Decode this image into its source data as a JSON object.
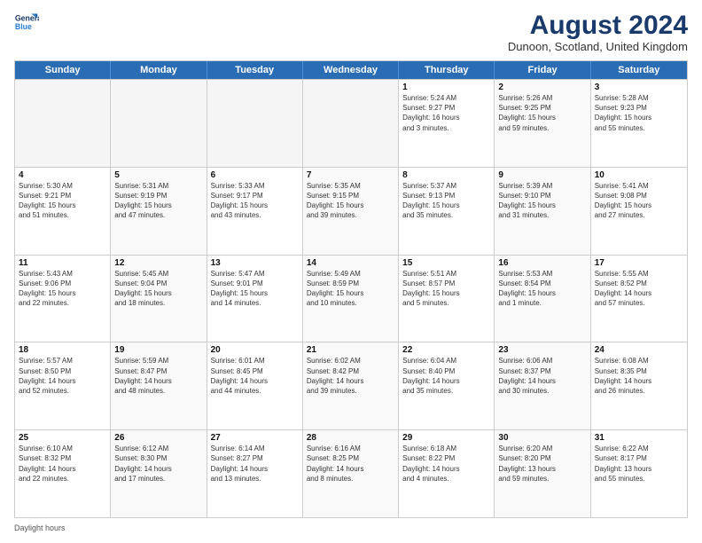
{
  "logo": {
    "line1": "General",
    "line2": "Blue"
  },
  "title": "August 2024",
  "location": "Dunoon, Scotland, United Kingdom",
  "days_of_week": [
    "Sunday",
    "Monday",
    "Tuesday",
    "Wednesday",
    "Thursday",
    "Friday",
    "Saturday"
  ],
  "footer_text": "Daylight hours",
  "weeks": [
    [
      {
        "day": "",
        "empty": true
      },
      {
        "day": "",
        "empty": true
      },
      {
        "day": "",
        "empty": true
      },
      {
        "day": "",
        "empty": true
      },
      {
        "day": "1",
        "info": "Sunrise: 5:24 AM\nSunset: 9:27 PM\nDaylight: 16 hours\nand 3 minutes."
      },
      {
        "day": "2",
        "info": "Sunrise: 5:26 AM\nSunset: 9:25 PM\nDaylight: 15 hours\nand 59 minutes."
      },
      {
        "day": "3",
        "info": "Sunrise: 5:28 AM\nSunset: 9:23 PM\nDaylight: 15 hours\nand 55 minutes."
      }
    ],
    [
      {
        "day": "4",
        "info": "Sunrise: 5:30 AM\nSunset: 9:21 PM\nDaylight: 15 hours\nand 51 minutes."
      },
      {
        "day": "5",
        "info": "Sunrise: 5:31 AM\nSunset: 9:19 PM\nDaylight: 15 hours\nand 47 minutes."
      },
      {
        "day": "6",
        "info": "Sunrise: 5:33 AM\nSunset: 9:17 PM\nDaylight: 15 hours\nand 43 minutes."
      },
      {
        "day": "7",
        "info": "Sunrise: 5:35 AM\nSunset: 9:15 PM\nDaylight: 15 hours\nand 39 minutes."
      },
      {
        "day": "8",
        "info": "Sunrise: 5:37 AM\nSunset: 9:13 PM\nDaylight: 15 hours\nand 35 minutes."
      },
      {
        "day": "9",
        "info": "Sunrise: 5:39 AM\nSunset: 9:10 PM\nDaylight: 15 hours\nand 31 minutes."
      },
      {
        "day": "10",
        "info": "Sunrise: 5:41 AM\nSunset: 9:08 PM\nDaylight: 15 hours\nand 27 minutes."
      }
    ],
    [
      {
        "day": "11",
        "info": "Sunrise: 5:43 AM\nSunset: 9:06 PM\nDaylight: 15 hours\nand 22 minutes."
      },
      {
        "day": "12",
        "info": "Sunrise: 5:45 AM\nSunset: 9:04 PM\nDaylight: 15 hours\nand 18 minutes."
      },
      {
        "day": "13",
        "info": "Sunrise: 5:47 AM\nSunset: 9:01 PM\nDaylight: 15 hours\nand 14 minutes."
      },
      {
        "day": "14",
        "info": "Sunrise: 5:49 AM\nSunset: 8:59 PM\nDaylight: 15 hours\nand 10 minutes."
      },
      {
        "day": "15",
        "info": "Sunrise: 5:51 AM\nSunset: 8:57 PM\nDaylight: 15 hours\nand 5 minutes."
      },
      {
        "day": "16",
        "info": "Sunrise: 5:53 AM\nSunset: 8:54 PM\nDaylight: 15 hours\nand 1 minute."
      },
      {
        "day": "17",
        "info": "Sunrise: 5:55 AM\nSunset: 8:52 PM\nDaylight: 14 hours\nand 57 minutes."
      }
    ],
    [
      {
        "day": "18",
        "info": "Sunrise: 5:57 AM\nSunset: 8:50 PM\nDaylight: 14 hours\nand 52 minutes."
      },
      {
        "day": "19",
        "info": "Sunrise: 5:59 AM\nSunset: 8:47 PM\nDaylight: 14 hours\nand 48 minutes."
      },
      {
        "day": "20",
        "info": "Sunrise: 6:01 AM\nSunset: 8:45 PM\nDaylight: 14 hours\nand 44 minutes."
      },
      {
        "day": "21",
        "info": "Sunrise: 6:02 AM\nSunset: 8:42 PM\nDaylight: 14 hours\nand 39 minutes."
      },
      {
        "day": "22",
        "info": "Sunrise: 6:04 AM\nSunset: 8:40 PM\nDaylight: 14 hours\nand 35 minutes."
      },
      {
        "day": "23",
        "info": "Sunrise: 6:06 AM\nSunset: 8:37 PM\nDaylight: 14 hours\nand 30 minutes."
      },
      {
        "day": "24",
        "info": "Sunrise: 6:08 AM\nSunset: 8:35 PM\nDaylight: 14 hours\nand 26 minutes."
      }
    ],
    [
      {
        "day": "25",
        "info": "Sunrise: 6:10 AM\nSunset: 8:32 PM\nDaylight: 14 hours\nand 22 minutes."
      },
      {
        "day": "26",
        "info": "Sunrise: 6:12 AM\nSunset: 8:30 PM\nDaylight: 14 hours\nand 17 minutes."
      },
      {
        "day": "27",
        "info": "Sunrise: 6:14 AM\nSunset: 8:27 PM\nDaylight: 14 hours\nand 13 minutes."
      },
      {
        "day": "28",
        "info": "Sunrise: 6:16 AM\nSunset: 8:25 PM\nDaylight: 14 hours\nand 8 minutes."
      },
      {
        "day": "29",
        "info": "Sunrise: 6:18 AM\nSunset: 8:22 PM\nDaylight: 14 hours\nand 4 minutes."
      },
      {
        "day": "30",
        "info": "Sunrise: 6:20 AM\nSunset: 8:20 PM\nDaylight: 13 hours\nand 59 minutes."
      },
      {
        "day": "31",
        "info": "Sunrise: 6:22 AM\nSunset: 8:17 PM\nDaylight: 13 hours\nand 55 minutes."
      }
    ]
  ]
}
